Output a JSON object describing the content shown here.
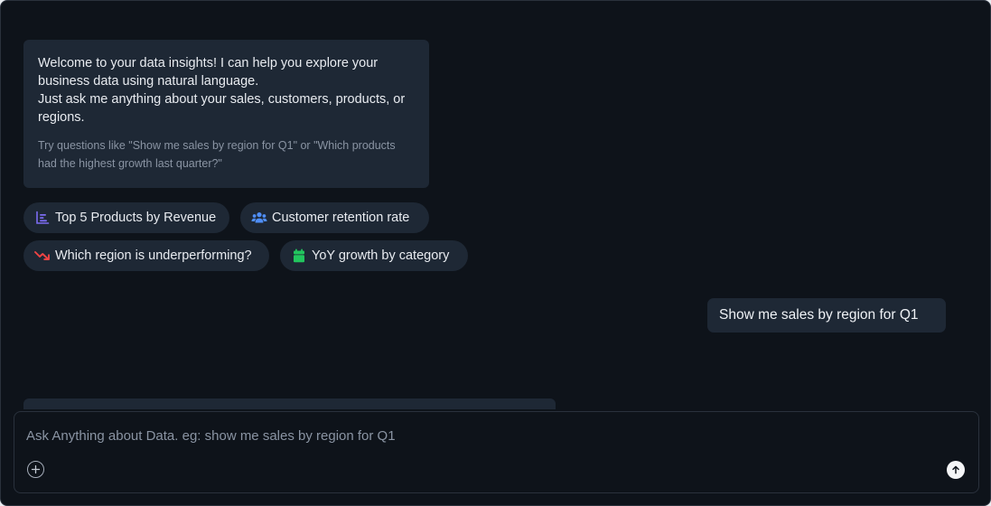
{
  "welcome": {
    "line1": "Welcome to your data insights! I can help you explore your business data using natural language.",
    "line2": "Just ask me anything about your sales, customers, products, or regions.",
    "hint": "Try questions like \"Show me sales by region for Q1\" or \"Which products had the highest growth last quarter?\""
  },
  "suggestions": [
    {
      "label": "Top 5 Products by Revenue",
      "icon": "bar-chart-icon",
      "color": "#7c6cf2"
    },
    {
      "label": "Customer retention rate",
      "icon": "users-icon",
      "color": "#4f8ef7"
    },
    {
      "label": "Which region is underperforming?",
      "icon": "trend-down-icon",
      "color": "#ef4444"
    },
    {
      "label": "YoY growth by category",
      "icon": "calendar-icon",
      "color": "#22c55e"
    }
  ],
  "conversation": {
    "user_message": "Show me sales by region for Q1"
  },
  "composer": {
    "placeholder": "Ask Anything about Data. eg: show me sales by region for Q1",
    "value": ""
  },
  "colors": {
    "background": "#0e131a",
    "card": "#1e2835",
    "border": "#2a313c",
    "muted_text": "#8a94a3"
  }
}
